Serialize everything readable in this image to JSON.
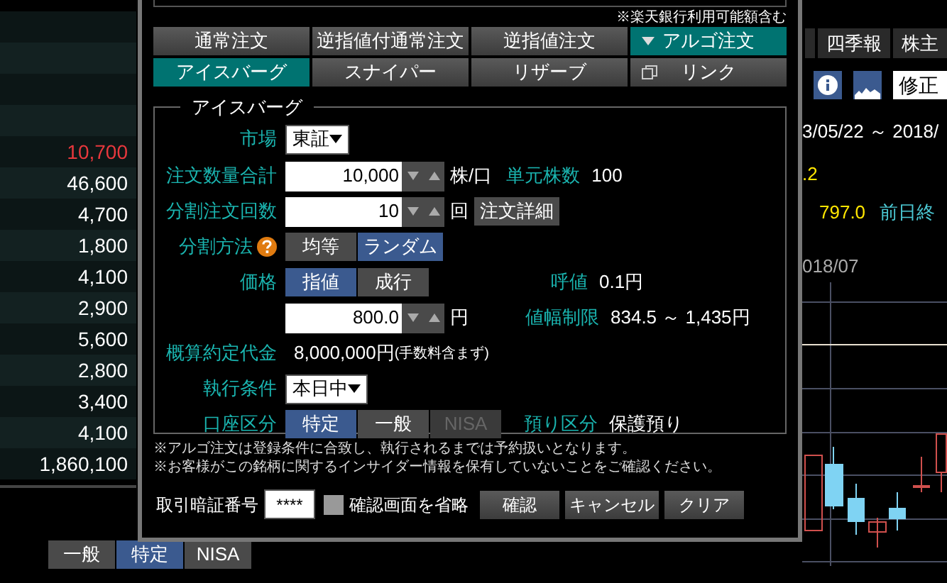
{
  "price_list": [
    {
      "value": "10,700",
      "color": "#e8383d"
    },
    {
      "value": "46,600",
      "color": "#ffffff"
    },
    {
      "value": "4,700",
      "color": "#ffffff"
    },
    {
      "value": "1,800",
      "color": "#ffffff"
    },
    {
      "value": "4,100",
      "color": "#ffffff"
    },
    {
      "value": "2,900",
      "color": "#ffffff"
    },
    {
      "value": "5,600",
      "color": "#ffffff"
    },
    {
      "value": "2,800",
      "color": "#ffffff"
    },
    {
      "value": "3,400",
      "color": "#ffffff"
    },
    {
      "value": "4,100",
      "color": "#ffffff"
    },
    {
      "value": "1,860,100",
      "color": "#ffffff"
    }
  ],
  "account_tabs": [
    {
      "label": "一般",
      "selected": false
    },
    {
      "label": "特定",
      "selected": true
    },
    {
      "label": "NISA",
      "selected": false
    }
  ],
  "right_panel": {
    "tabs": [
      "四季報",
      "株主"
    ],
    "stock_field": {
      "value": "修正"
    },
    "date_range": "3/05/22 ～ 2018/",
    "change": ".2",
    "price": "797.0",
    "prev_close_label": "前日終",
    "chart_label": "018/07"
  },
  "dialog": {
    "top_note": "※楽天銀行利用可能額含む",
    "order_tabs": [
      {
        "label": "通常注文",
        "selected": false,
        "caret": false
      },
      {
        "label": "逆指値付通常注文",
        "selected": false,
        "caret": false
      },
      {
        "label": "逆指値注文",
        "selected": false,
        "caret": false
      },
      {
        "label": "アルゴ注文",
        "selected": true,
        "caret": true
      }
    ],
    "algo_tabs": [
      {
        "label": "アイスバーグ",
        "selected": true,
        "icon": false
      },
      {
        "label": "スナイパー",
        "selected": false,
        "icon": false
      },
      {
        "label": "リザーブ",
        "selected": false,
        "icon": false
      },
      {
        "label": "リンク",
        "selected": false,
        "icon": true
      }
    ],
    "legend": "アイスバーグ",
    "market": {
      "label": "市場",
      "value": "東証"
    },
    "quantity": {
      "label": "注文数量合計",
      "value": "10,000",
      "unit": "株/口",
      "unit_label": "単元株数",
      "unit_value": "100"
    },
    "splits": {
      "label": "分割注文回数",
      "value": "10",
      "unit": "回",
      "detail_button": "注文詳細"
    },
    "split_method": {
      "label": "分割方法",
      "options": [
        {
          "label": "均等",
          "selected": false
        },
        {
          "label": "ランダム",
          "selected": true
        }
      ]
    },
    "price_type": {
      "label": "価格",
      "options": [
        {
          "label": "指値",
          "selected": true
        },
        {
          "label": "成行",
          "selected": false
        }
      ],
      "tick_label": "呼値",
      "tick_value": "0.1円"
    },
    "price": {
      "value": "800.0",
      "unit": "円",
      "limit_label": "値幅制限",
      "limit_value": "834.5 ～ 1,435円"
    },
    "estimate": {
      "label": "概算約定代金",
      "value": "8,000,000円",
      "note": "(手数料含まず)"
    },
    "condition": {
      "label": "執行条件",
      "value": "本日中"
    },
    "account": {
      "label": "口座区分",
      "options": [
        {
          "label": "特定",
          "selected": true,
          "disabled": false
        },
        {
          "label": "一般",
          "selected": false,
          "disabled": false
        },
        {
          "label": "NISA",
          "selected": false,
          "disabled": true
        }
      ],
      "custody_label": "預り区分",
      "custody_value": "保護預り"
    },
    "notes": [
      "※アルゴ注文は登録条件に合致し、執行されるまでは予約扱いとなります。",
      "※お客様がこの銘柄に関するインサイダー情報を保有していないことをご確認ください。"
    ],
    "pin": {
      "label": "取引暗証番号",
      "value": "****"
    },
    "skip_confirm": {
      "label": "確認画面を省略",
      "checked": false
    },
    "buttons": [
      "確認",
      "キャンセル",
      "クリア"
    ]
  }
}
